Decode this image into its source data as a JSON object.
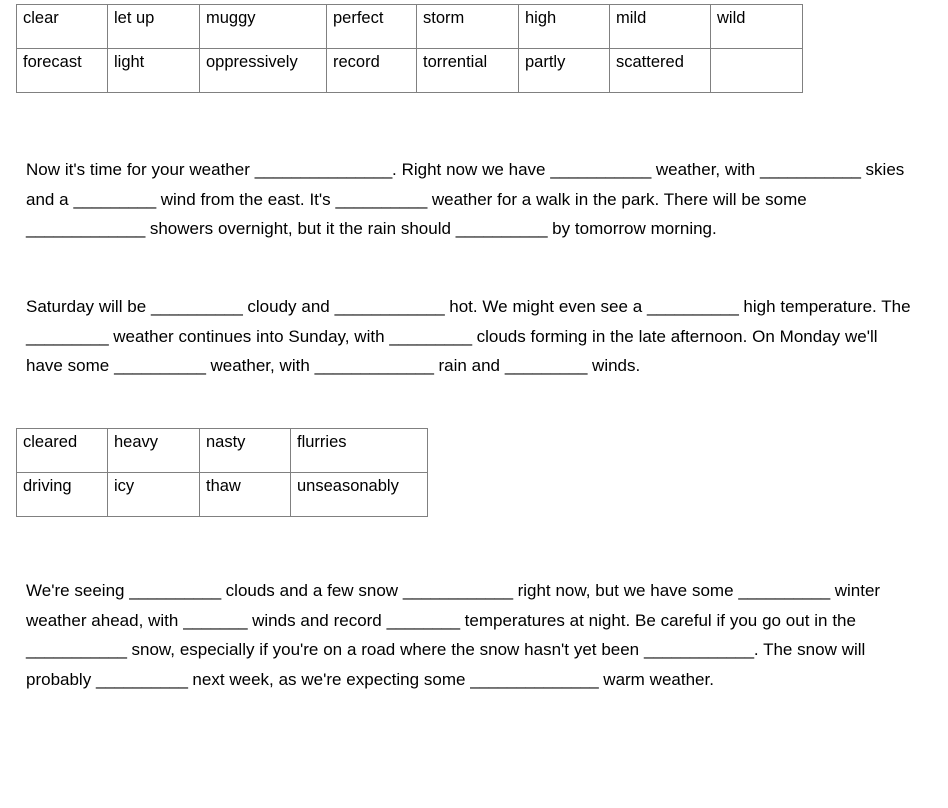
{
  "document": {
    "type": "weather-vocabulary-gap-fill-worksheet"
  },
  "word_bank_one": {
    "name": "word-bank-table-one",
    "columns": 8,
    "rows": [
      [
        "clear",
        "let up",
        "muggy",
        "perfect",
        "storm",
        "high",
        "mild",
        "wild"
      ],
      [
        "forecast",
        "light",
        "oppressively",
        "record",
        "torrential",
        "partly",
        "scattered",
        ""
      ]
    ]
  },
  "word_bank_two": {
    "name": "word-bank-table-two",
    "columns": 4,
    "rows": [
      [
        "cleared",
        "heavy",
        "nasty",
        "flurries"
      ],
      [
        "driving",
        "icy",
        "thaw",
        "unseasonably"
      ]
    ]
  },
  "paragraphs": {
    "one": {
      "segments": [
        {
          "type": "text",
          "value": "Now it's time for your weather "
        },
        {
          "type": "blank",
          "value": "_______________"
        },
        {
          "type": "text",
          "value": ". Right now we have "
        },
        {
          "type": "blank",
          "value": "___________"
        },
        {
          "type": "text",
          "value": " weather, with "
        },
        {
          "type": "blank",
          "value": "___________"
        },
        {
          "type": "text",
          "value": " skies and a "
        },
        {
          "type": "blank",
          "value": "_________"
        },
        {
          "type": "text",
          "value": " wind from the east. It's "
        },
        {
          "type": "blank",
          "value": "__________"
        },
        {
          "type": "text",
          "value": " weather for a walk in the park. There will be some "
        },
        {
          "type": "blank",
          "value": "_____________"
        },
        {
          "type": "text",
          "value": " showers overnight, but it the rain should "
        },
        {
          "type": "blank",
          "value": "__________"
        },
        {
          "type": "text",
          "value": " by tomorrow morning."
        }
      ]
    },
    "two": {
      "segments": [
        {
          "type": "text",
          "value": "Saturday will be "
        },
        {
          "type": "blank",
          "value": "__________"
        },
        {
          "type": "text",
          "value": " cloudy and "
        },
        {
          "type": "blank",
          "value": "____________"
        },
        {
          "type": "text",
          "value": " hot. We might even see a "
        },
        {
          "type": "blank",
          "value": "__________"
        },
        {
          "type": "text",
          "value": " high temperature. The "
        },
        {
          "type": "blank",
          "value": "_________"
        },
        {
          "type": "text",
          "value": " weather continues into Sunday, with "
        },
        {
          "type": "blank",
          "value": "_________"
        },
        {
          "type": "text",
          "value": " clouds forming in the late afternoon. On Monday we'll have some "
        },
        {
          "type": "blank",
          "value": "__________"
        },
        {
          "type": "text",
          "value": " weather, with "
        },
        {
          "type": "blank",
          "value": "_____________"
        },
        {
          "type": "text",
          "value": " rain and "
        },
        {
          "type": "blank",
          "value": "_________"
        },
        {
          "type": "text",
          "value": " winds."
        }
      ]
    },
    "three": {
      "segments": [
        {
          "type": "text",
          "value": "We're seeing "
        },
        {
          "type": "blank",
          "value": "__________"
        },
        {
          "type": "text",
          "value": " clouds and a few snow "
        },
        {
          "type": "blank",
          "value": "____________"
        },
        {
          "type": "text",
          "value": " right now, but we have some "
        },
        {
          "type": "blank",
          "value": "__________"
        },
        {
          "type": "text",
          "value": " winter weather ahead, with "
        },
        {
          "type": "blank",
          "value": "_______"
        },
        {
          "type": "text",
          "value": " winds and record "
        },
        {
          "type": "blank",
          "value": "________"
        },
        {
          "type": "text",
          "value": " temperatures at night. Be careful if you go out in the "
        },
        {
          "type": "blank",
          "value": "___________"
        },
        {
          "type": "text",
          "value": " snow, especially if you're on a road where the snow hasn't yet been "
        },
        {
          "type": "blank",
          "value": "____________"
        },
        {
          "type": "text",
          "value": ". The snow will probably "
        },
        {
          "type": "blank",
          "value": "__________"
        },
        {
          "type": "text",
          "value": " next week, as we're expecting some "
        },
        {
          "type": "blank",
          "value": "______________"
        },
        {
          "type": "text",
          "value": " warm weather."
        }
      ]
    }
  }
}
